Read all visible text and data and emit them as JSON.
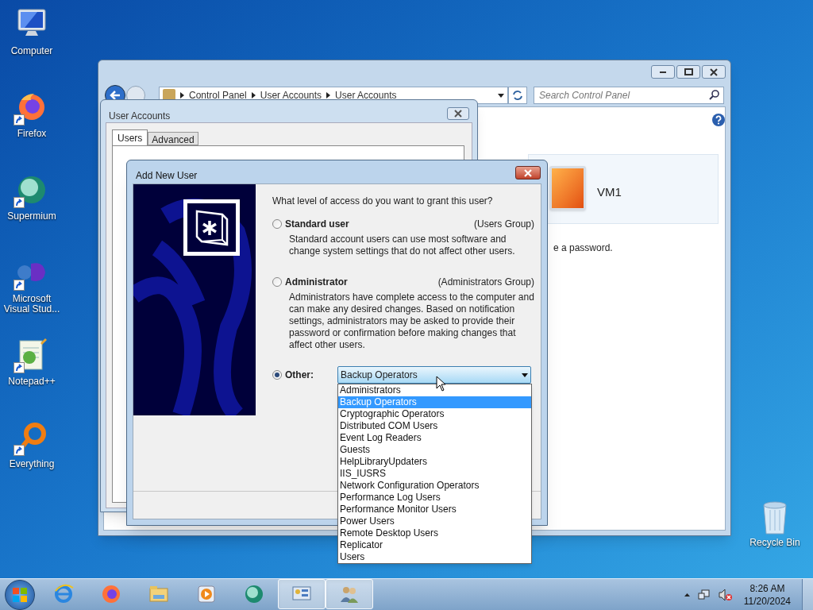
{
  "desktop_icons": [
    {
      "label": "Computer",
      "kind": "computer",
      "shortcut": false
    },
    {
      "label": "Firefox",
      "kind": "firefox",
      "shortcut": true
    },
    {
      "label": "Supermium",
      "kind": "supermium",
      "shortcut": true
    },
    {
      "label": "Microsoft Visual Stud...",
      "kind": "vs",
      "shortcut": true
    },
    {
      "label": "Notepad++",
      "kind": "notepad",
      "shortcut": true
    },
    {
      "label": "Everything",
      "kind": "everything",
      "shortcut": true
    }
  ],
  "recycle_bin": {
    "label": "Recycle Bin"
  },
  "control_panel": {
    "breadcrumb": [
      "Control Panel",
      "User Accounts",
      "User Accounts"
    ],
    "search": {
      "placeholder": "Search Control Panel"
    },
    "account_name": "VM1",
    "partial_text": "e a password."
  },
  "user_accounts": {
    "title": "User Accounts",
    "tabs": [
      {
        "label": "Users",
        "selected": true
      },
      {
        "label": "Advanced",
        "selected": false
      }
    ]
  },
  "add_user": {
    "title": "Add New User",
    "question": "What level of access do you want to grant this user?",
    "options": [
      {
        "kind": "described",
        "label": "Standard user",
        "group": "(Users Group)",
        "description": "Standard account users can use most software and change system settings that do not affect other users.",
        "selected": false
      },
      {
        "kind": "described",
        "label": "Administrator",
        "group": "(Administrators Group)",
        "description": "Administrators have complete access to the computer and can make any desired changes. Based on notification settings, administrators may be asked to provide their password or confirmation before making changes that affect other users.",
        "selected": false
      },
      {
        "kind": "combo",
        "label": "Other:",
        "selected": true
      }
    ],
    "combo": {
      "value": "Backup Operators",
      "expanded": true,
      "items": [
        {
          "label": "Administrators",
          "selected": false
        },
        {
          "label": "Backup Operators",
          "selected": true
        },
        {
          "label": "Cryptographic Operators",
          "selected": false
        },
        {
          "label": "Distributed COM Users",
          "selected": false
        },
        {
          "label": "Event Log Readers",
          "selected": false
        },
        {
          "label": "Guests",
          "selected": false
        },
        {
          "label": "HelpLibraryUpdaters",
          "selected": false
        },
        {
          "label": "IIS_IUSRS",
          "selected": false
        },
        {
          "label": "Network Configuration Operators",
          "selected": false
        },
        {
          "label": "Performance Log Users",
          "selected": false
        },
        {
          "label": "Performance Monitor Users",
          "selected": false
        },
        {
          "label": "Power Users",
          "selected": false
        },
        {
          "label": "Remote Desktop Users",
          "selected": false
        },
        {
          "label": "Replicator",
          "selected": false
        },
        {
          "label": "Users",
          "selected": false
        }
      ]
    }
  },
  "taskbar": {
    "apps": [
      {
        "kind": "ie",
        "active": false
      },
      {
        "kind": "firefox",
        "active": false
      },
      {
        "kind": "explorer",
        "active": false
      },
      {
        "kind": "media",
        "active": false
      },
      {
        "kind": "supermium",
        "active": false
      },
      {
        "kind": "controlpanel",
        "active": true
      },
      {
        "kind": "users",
        "active": true
      }
    ],
    "time": "8:26 AM",
    "date": "11/20/2024"
  }
}
